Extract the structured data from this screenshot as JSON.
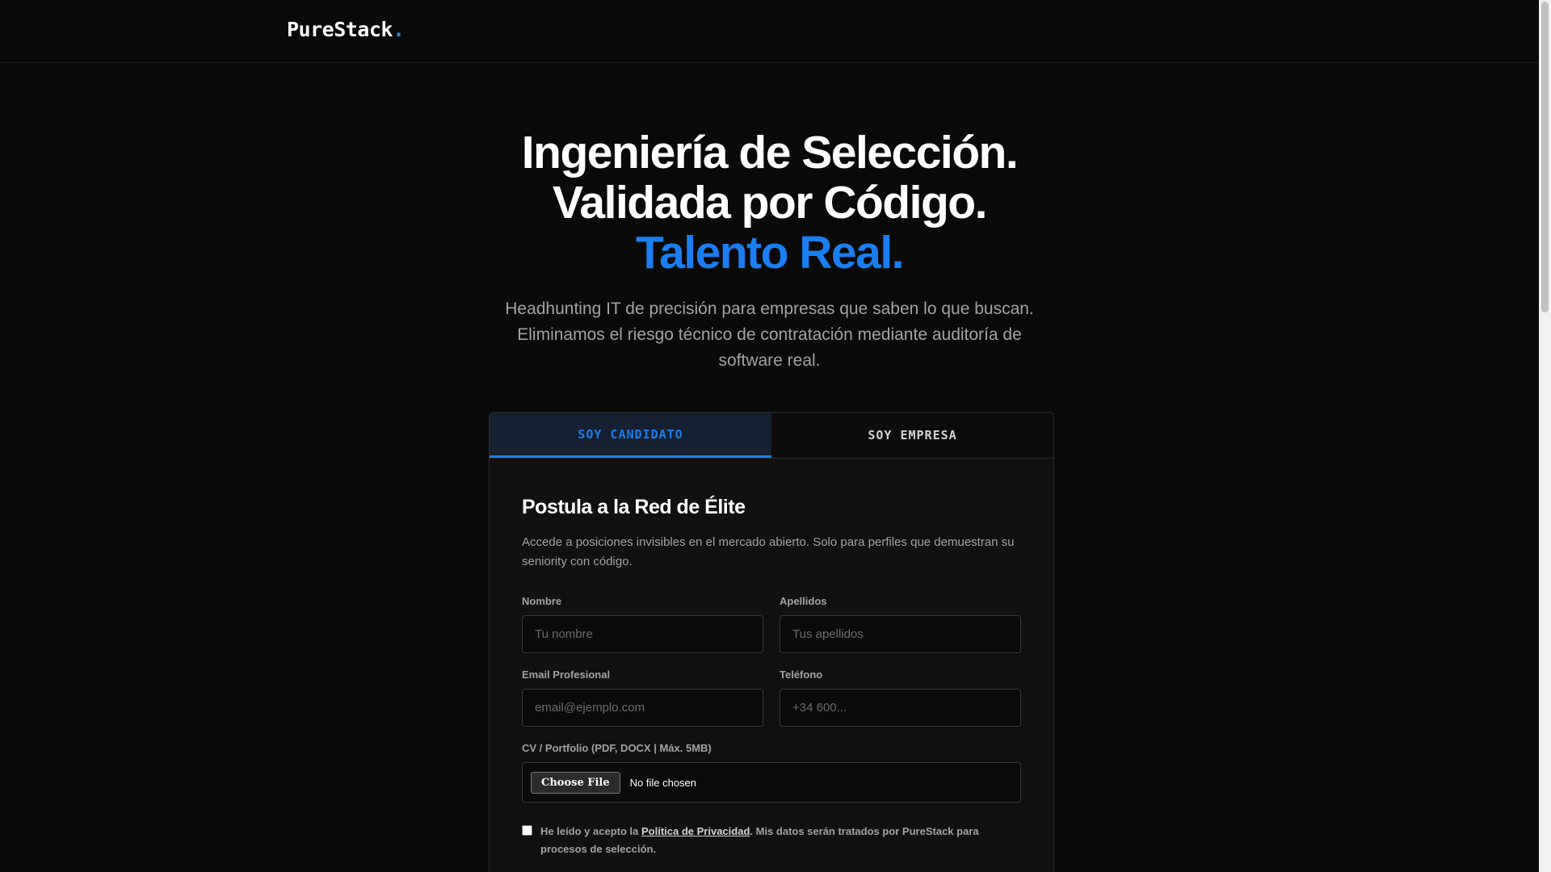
{
  "header": {
    "logo_text": "PureStack",
    "logo_dot": "."
  },
  "hero": {
    "title_line1": "Ingeniería de Selección.",
    "title_line2": "Validada por Código.",
    "title_accent": "Talento Real.",
    "subtitle": "Headhunting IT de precisión para empresas que saben lo que buscan. Eliminamos el riesgo técnico de contratación mediante auditoría de software real."
  },
  "tabs": [
    {
      "label": "SOY CANDIDATO",
      "active": true
    },
    {
      "label": "SOY EMPRESA",
      "active": false
    }
  ],
  "form": {
    "title": "Postula a la Red de Élite",
    "description": "Accede a posiciones invisibles en el mercado abierto. Solo para perfiles que demuestran su seniority con código.",
    "fields": {
      "nombre": {
        "label": "Nombre",
        "placeholder": "Tu nombre",
        "value": ""
      },
      "apellidos": {
        "label": "Apellidos",
        "placeholder": "Tus apellidos",
        "value": ""
      },
      "email": {
        "label": "Email Profesional",
        "placeholder": "email@ejemplo.com",
        "value": ""
      },
      "telefono": {
        "label": "Teléfono",
        "placeholder": "+34 600...",
        "value": ""
      }
    },
    "file": {
      "label": "CV / Portfolio (PDF, DOCX | Máx. 5MB)",
      "button": "Choose File",
      "status": "No file chosen"
    },
    "consent": {
      "prefix": "He leído y acepto la ",
      "link": "Política de Privacidad",
      "suffix": ". Mis datos serán tratados por PureStack para procesos de selección.",
      "checked": false
    }
  },
  "colors": {
    "accent": "#1a7ef0",
    "background": "#0a0a0a",
    "card": "#111111"
  }
}
